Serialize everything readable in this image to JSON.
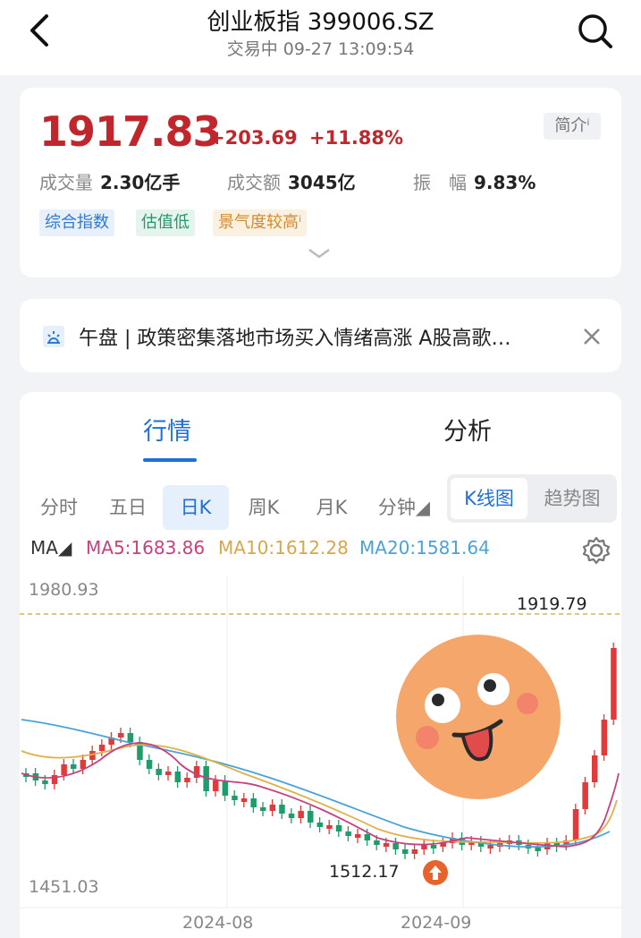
{
  "header": {
    "title": "创业板指 399006.SZ",
    "subtitle": "交易中 09-27 13:09:54"
  },
  "quote": {
    "price": "1917.83",
    "change": "+203.69",
    "change_pct": "+11.88%",
    "intro": "简介ⁱ",
    "volume_label": "成交量",
    "volume": "2.30亿手",
    "amount_label": "成交额",
    "amount": "3045亿",
    "amp_label": "振　幅",
    "amp": "9.83%"
  },
  "tags": [
    {
      "label": "综合指数",
      "color": "#2f78d4",
      "bg": "#e8f0fb"
    },
    {
      "label": "估值低",
      "color": "#1f9a6a",
      "bg": "#e5f5ee"
    },
    {
      "label": "景气度较高ⁱ",
      "color": "#d58a2a",
      "bg": "#fbf1e3"
    }
  ],
  "news": {
    "text": "午盘 | 政策密集落地市场买入情绪高涨 A股高歌…"
  },
  "tabs": [
    "行情",
    "分析"
  ],
  "periods": [
    "分时",
    "五日",
    "日K",
    "周K",
    "月K",
    "分钟◢"
  ],
  "chart_mode": [
    "K线图",
    "趋势图"
  ],
  "ma": {
    "label": "MA◢",
    "ma5": "MA5:1683.86",
    "ma10": "MA10:1612.28",
    "ma20": "MA20:1581.64",
    "c5": "#c9407d",
    "c10": "#e0b04a",
    "c20": "#4aa3d8"
  },
  "chart_data": {
    "type": "candlestick",
    "y_max": "1980.93",
    "y_min": "1451.03",
    "high_label": "1919.79",
    "low_label": "1512.17",
    "x_ticks": [
      "2024-08",
      "2024-09"
    ],
    "up_color": "#e03a3a",
    "down_color": "#1e9c6a"
  }
}
